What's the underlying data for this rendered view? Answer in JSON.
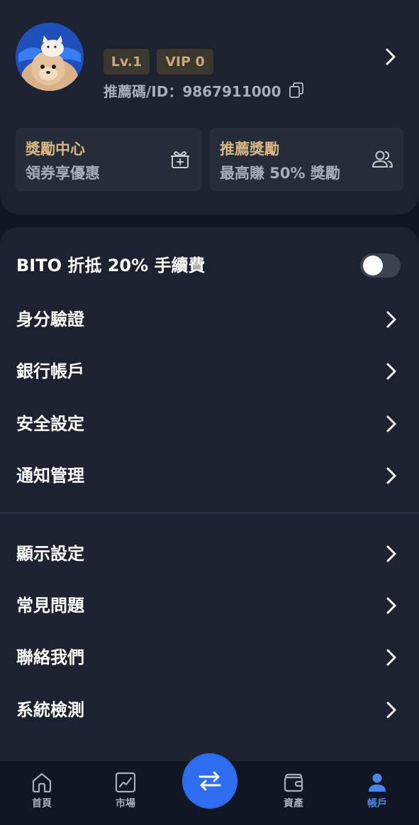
{
  "profile": {
    "level_badge": "Lv.1",
    "vip_badge": "VIP 0",
    "referral": "推薦碼/ID：9867911000"
  },
  "promos": [
    {
      "title": "獎勵中心",
      "subtitle": "領券享優惠",
      "icon": "gift-icon"
    },
    {
      "title": "推薦獎勵",
      "subtitle": "最高賺 50% 獎勵",
      "icon": "users-icon"
    }
  ],
  "settings": {
    "fee_discount": {
      "label": "BITO 折抵 20% 手續費",
      "enabled": false
    },
    "group1": [
      {
        "label": "身分驗證"
      },
      {
        "label": "銀行帳戶"
      },
      {
        "label": "安全設定"
      },
      {
        "label": "通知管理"
      }
    ],
    "group2": [
      {
        "label": "顯示設定"
      },
      {
        "label": "常見問題"
      },
      {
        "label": "聯絡我們"
      },
      {
        "label": "系統檢測"
      }
    ]
  },
  "nav": {
    "items": [
      {
        "label": "首頁",
        "icon": "home-icon"
      },
      {
        "label": "市場",
        "icon": "chart-icon"
      },
      {
        "label": "",
        "icon": "swap-icon"
      },
      {
        "label": "資產",
        "icon": "wallet-icon"
      },
      {
        "label": "帳戶",
        "icon": "account-icon",
        "active": true
      }
    ]
  },
  "colors": {
    "accent": "#2e6cf0",
    "gold": "#d8b686",
    "background": "#1d2230"
  }
}
